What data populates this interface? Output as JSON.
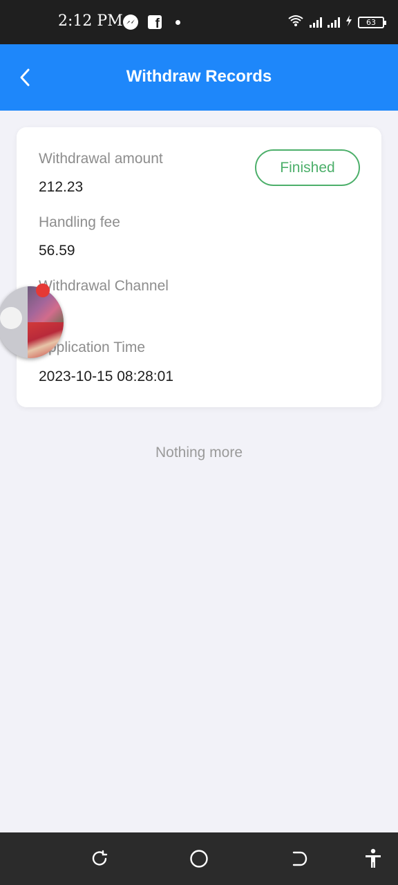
{
  "status_bar": {
    "time": "2:12 PM",
    "battery": "63",
    "icons": [
      "messenger-icon",
      "facebook-icon",
      "notification-dot-icon",
      "wifi-icon",
      "signal-icon",
      "signal-icon",
      "charging-icon",
      "battery-icon"
    ]
  },
  "header": {
    "title": "Withdraw Records",
    "back_icon": "chevron-left-icon",
    "background": "#1e87fa"
  },
  "record": {
    "status": "Finished",
    "status_color": "#4caf6a",
    "fields": [
      {
        "label": "Withdrawal amount",
        "value": "212.23"
      },
      {
        "label": "Handling fee",
        "value": "56.59"
      },
      {
        "label": "Withdrawal Channel",
        "value": "va"
      },
      {
        "label": "Application Time",
        "value": "2023-10-15 08:28:01"
      }
    ]
  },
  "list_end_text": "Nothing more",
  "nav_bar": {
    "icons": [
      "recents-icon",
      "home-icon",
      "back-icon",
      "accessibility-icon"
    ]
  }
}
